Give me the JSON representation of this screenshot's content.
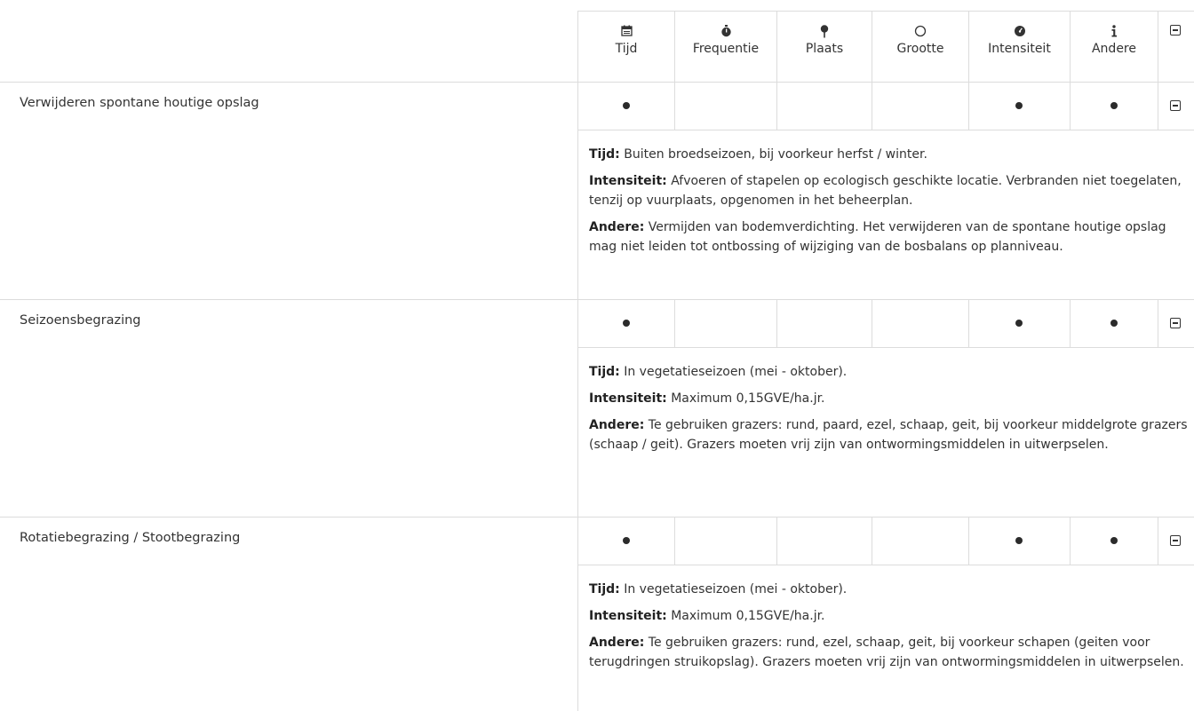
{
  "columns": [
    {
      "icon": "calendar-icon",
      "glyph": "📅",
      "label": "Tijd"
    },
    {
      "icon": "stopwatch-icon",
      "glyph": "⏱",
      "label": "Frequentie"
    },
    {
      "icon": "pin-icon",
      "glyph": "📍",
      "label": "Plaats"
    },
    {
      "icon": "circle-icon",
      "glyph": "○",
      "label": "Grootte"
    },
    {
      "icon": "gauge-icon",
      "glyph": "◕",
      "label": "Intensiteit"
    },
    {
      "icon": "info-icon",
      "glyph": "i",
      "label": "Andere"
    }
  ],
  "rows": [
    {
      "title": "Verwijderen spontane houtige opslag",
      "marks": [
        true,
        false,
        false,
        false,
        true,
        true
      ],
      "details": [
        {
          "label": "Tijd:",
          "text": "Buiten broedseizoen, bij voorkeur herfst / winter."
        },
        {
          "label": "Intensiteit:",
          "text": "Afvoeren of stapelen op ecologisch geschikte locatie. Verbranden niet toegelaten, tenzij op vuurplaats, opgenomen in het beheerplan."
        },
        {
          "label": "Andere:",
          "text": "Vermijden van bodemverdichting. Het verwijderen van de spontane houtige opslag mag niet leiden tot ontbossing of wijziging van de bosbalans op planniveau."
        }
      ]
    },
    {
      "title": "Seizoensbegrazing",
      "marks": [
        true,
        false,
        false,
        false,
        true,
        true
      ],
      "details": [
        {
          "label": "Tijd:",
          "text": "In vegetatieseizoen (mei - oktober)."
        },
        {
          "label": "Intensiteit:",
          "text": "Maximum 0,15GVE/ha.jr."
        },
        {
          "label": "Andere:",
          "text": "Te gebruiken grazers: rund, paard, ezel, schaap, geit, bij voorkeur middelgrote grazers (schaap / geit). Grazers moeten vrij zijn van ontwormingsmiddelen in uitwerpselen."
        }
      ]
    },
    {
      "title": "Rotatiebegrazing / Stootbegrazing",
      "marks": [
        true,
        false,
        false,
        false,
        true,
        true
      ],
      "details": [
        {
          "label": "Tijd:",
          "text": "In vegetatieseizoen (mei - oktober)."
        },
        {
          "label": "Intensiteit:",
          "text": "Maximum 0,15GVE/ha.jr."
        },
        {
          "label": "Andere:",
          "text": "Te gebruiken grazers: rund, ezel, schaap, geit, bij voorkeur schapen (geiten voor terugdringen struikopslag). Grazers moeten vrij zijn van ontwormingsmiddelen in uitwerpselen."
        }
      ]
    }
  ]
}
